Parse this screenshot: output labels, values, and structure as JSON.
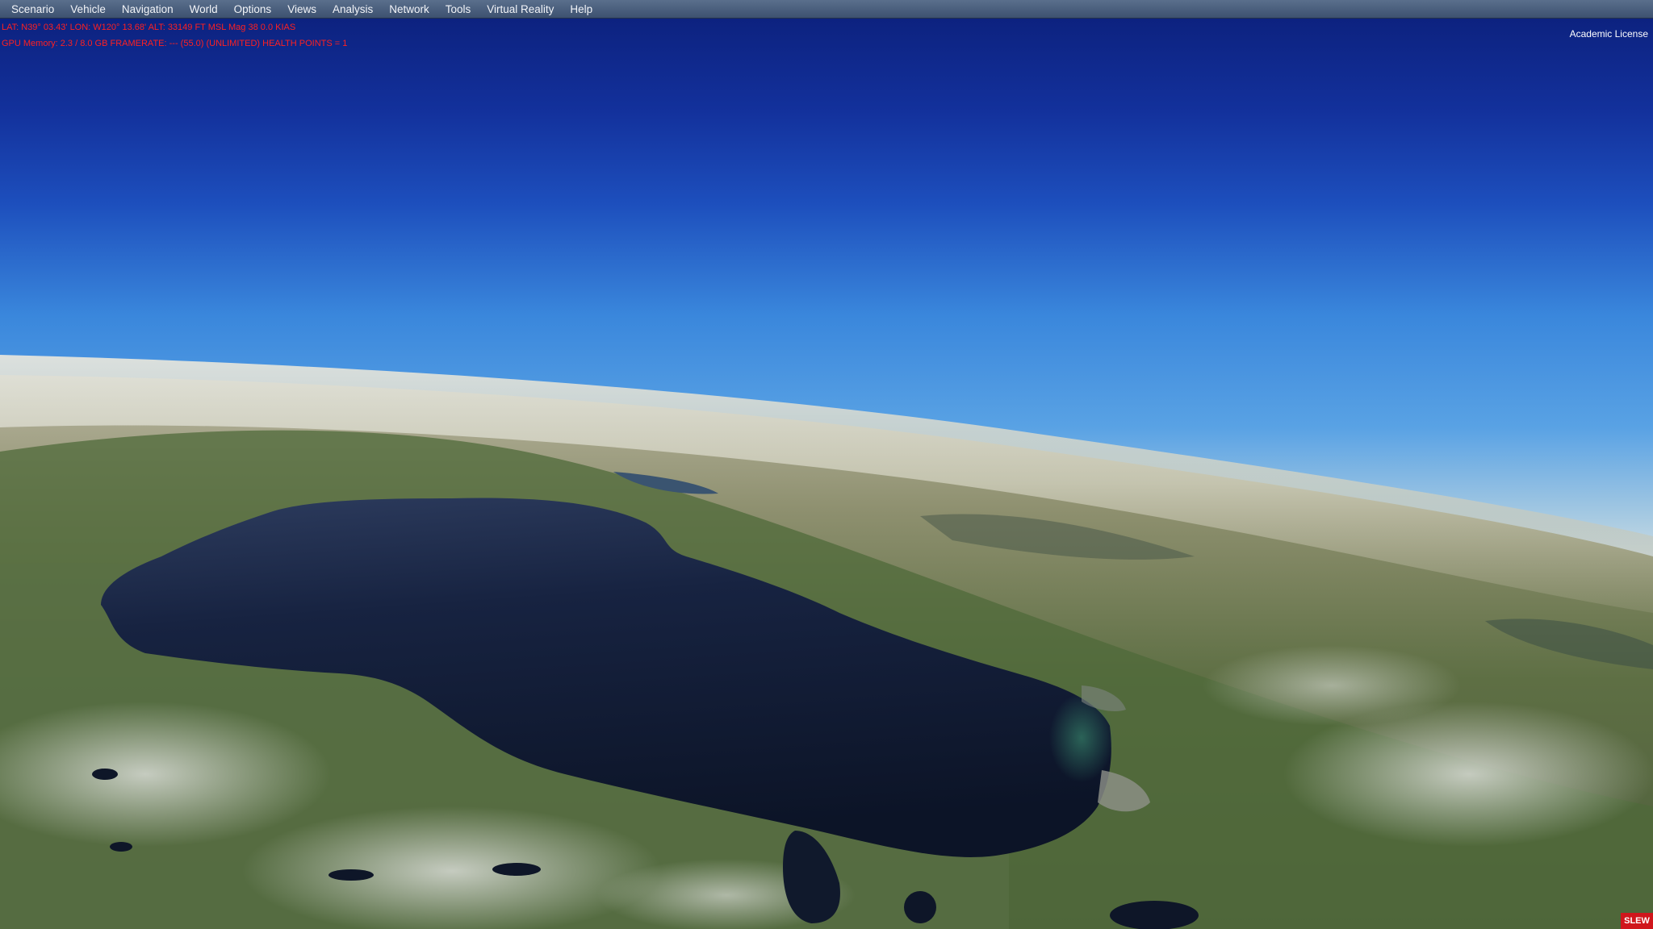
{
  "menubar": {
    "items": [
      {
        "label": "Scenario"
      },
      {
        "label": "Vehicle"
      },
      {
        "label": "Navigation"
      },
      {
        "label": "World"
      },
      {
        "label": "Options"
      },
      {
        "label": "Views"
      },
      {
        "label": "Analysis"
      },
      {
        "label": "Network"
      },
      {
        "label": "Tools"
      },
      {
        "label": "Virtual Reality"
      },
      {
        "label": "Help"
      }
    ]
  },
  "hud": {
    "line1": "LAT: N39° 03.43'   LON: W120° 13.68'   ALT: 33149 FT  MSL   Mag 38  0.0 KIAS",
    "line2": "GPU Memory: 2.3 / 8.0 GB  FRAMERATE: --- (55.0)  (UNLIMITED)   HEALTH POINTS = 1"
  },
  "license": "Academic License",
  "status": {
    "slew": "SLEW"
  },
  "colors": {
    "hud_text": "#ff2020",
    "menubar": "#4a5e7e",
    "slew_badge": "#d0161c",
    "sky_top": "#0f2a8c",
    "sky_mid": "#2f76d8",
    "lake": "#10172a"
  }
}
